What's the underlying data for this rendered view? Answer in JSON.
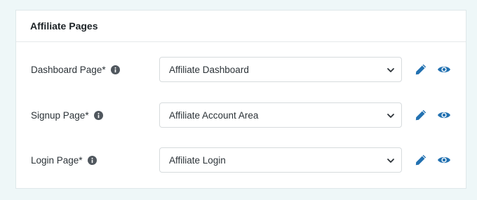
{
  "panel": {
    "title": "Affiliate Pages"
  },
  "rows": [
    {
      "label": "Dashboard Page*",
      "selected": "Affiliate Dashboard",
      "info_icon": "info-circle-icon",
      "edit_icon": "pencil-icon",
      "view_icon": "eye-icon"
    },
    {
      "label": "Signup Page*",
      "selected": "Affiliate Account Area",
      "info_icon": "info-circle-icon",
      "edit_icon": "pencil-icon",
      "view_icon": "eye-icon"
    },
    {
      "label": "Login Page*",
      "selected": "Affiliate Login",
      "info_icon": "info-circle-icon",
      "edit_icon": "pencil-icon",
      "view_icon": "eye-icon"
    }
  ],
  "colors": {
    "background": "#eef7f8",
    "accent": "#2271b1",
    "icon_dark": "#50575e"
  }
}
